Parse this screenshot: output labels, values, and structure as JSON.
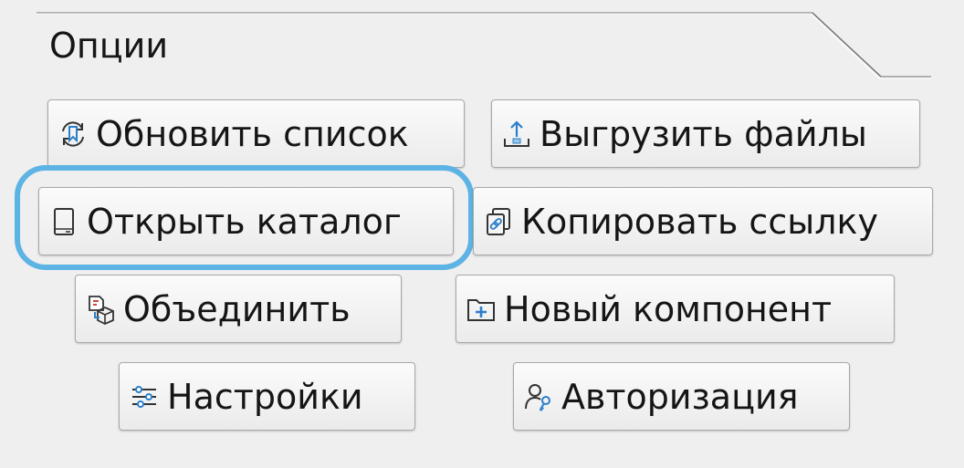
{
  "group": {
    "title": "Опции"
  },
  "buttons": [
    {
      "label": "Обновить список",
      "icon": "refresh-bookmark-icon"
    },
    {
      "label": "Выгрузить файлы",
      "icon": "upload-tray-icon"
    },
    {
      "label": "Открыть каталог",
      "icon": "device-catalog-icon",
      "focused": true
    },
    {
      "label": "Копировать ссылку",
      "icon": "copy-link-icon"
    },
    {
      "label": "Объединить",
      "icon": "merge-box-icon"
    },
    {
      "label": "Новый компонент",
      "icon": "new-folder-plus-icon"
    },
    {
      "label": "Настройки",
      "icon": "sliders-icon"
    },
    {
      "label": "Авторизация",
      "icon": "user-key-icon"
    }
  ],
  "colors": {
    "background": "#efefef",
    "focus_ring": "#5cb3e4",
    "icon_accent": "#2a7fc9"
  }
}
